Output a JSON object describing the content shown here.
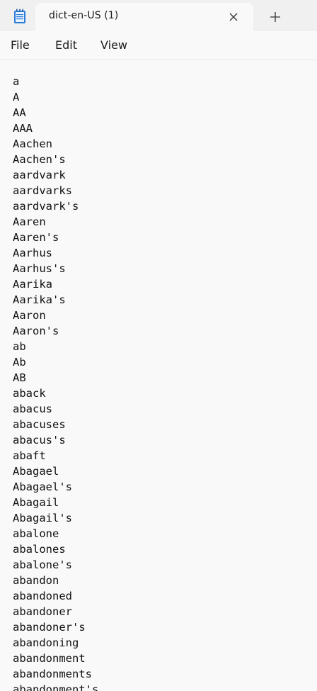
{
  "app": {
    "icon": "notepad-icon"
  },
  "tab": {
    "title": "dict-en-US (1)",
    "close_icon": "close-icon",
    "new_tab_icon": "plus-icon"
  },
  "menu": {
    "file": "File",
    "edit": "Edit",
    "view": "View"
  },
  "editor": {
    "lines": [
      "a",
      "A",
      "AA",
      "AAA",
      "Aachen",
      "Aachen's",
      "aardvark",
      "aardvarks",
      "aardvark's",
      "Aaren",
      "Aaren's",
      "Aarhus",
      "Aarhus's",
      "Aarika",
      "Aarika's",
      "Aaron",
      "Aaron's",
      "ab",
      "Ab",
      "AB",
      "aback",
      "abacus",
      "abacuses",
      "abacus's",
      "abaft",
      "Abagael",
      "Abagael's",
      "Abagail",
      "Abagail's",
      "abalone",
      "abalones",
      "abalone's",
      "abandon",
      "abandoned",
      "abandoner",
      "abandoner's",
      "abandoning",
      "abandonment",
      "abandonments",
      "abandonment's"
    ]
  },
  "colors": {
    "tabstrip_bg": "#f0f0f0",
    "window_bg": "#f9f9f9",
    "text": "#111111",
    "notepad_icon_blue": "#2b7bd8"
  }
}
